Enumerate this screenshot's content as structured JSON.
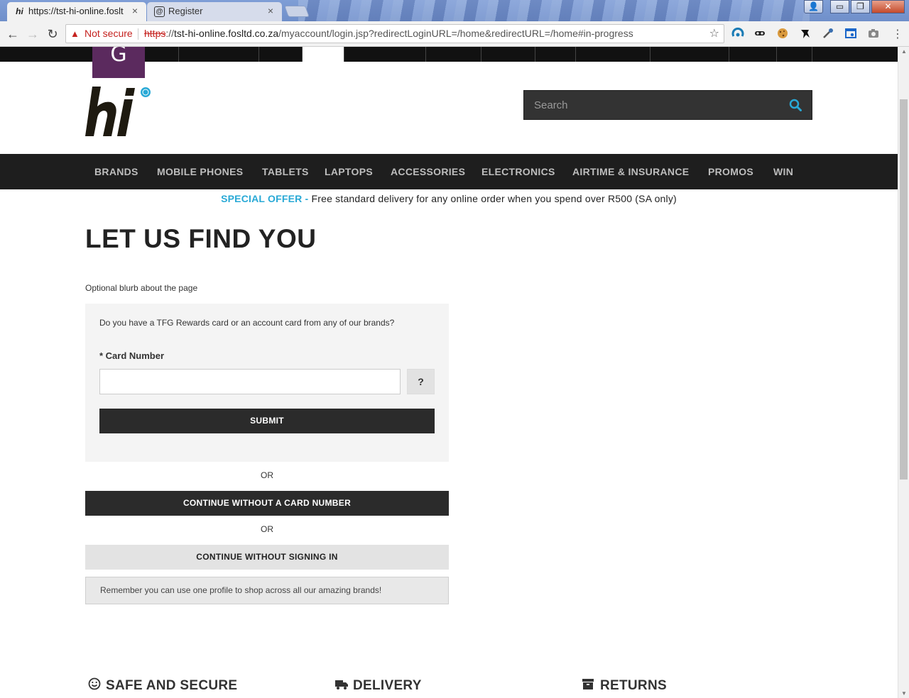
{
  "browser": {
    "tabs": [
      {
        "favicon": "hi",
        "title": "https://tst-hi-online.foslt",
        "close": "×"
      },
      {
        "favicon": "@",
        "title": "Register",
        "close": "×"
      }
    ],
    "window_buttons": {
      "minimize": "▭",
      "restore": "❐",
      "close": "✕",
      "user": "👤"
    },
    "nav": {
      "back": "←",
      "forward": "→",
      "reload": "↻"
    },
    "omnibox": {
      "warning_icon": "▲",
      "security_label": "Not secure",
      "scheme": "https",
      "scheme_rest": "://",
      "host": "tst-hi-online.fosltd.co.za",
      "path": "/myaccount/login.jsp?redirectLoginURL=/home&redirectURL=/home#in-progress",
      "star": "☆"
    },
    "menu": "⋮"
  },
  "brandbar": {
    "badge_letter": "G"
  },
  "search": {
    "placeholder": "Search"
  },
  "nav": {
    "items": [
      "BRANDS",
      "MOBILE PHONES",
      "TABLETS",
      "LAPTOPS",
      "ACCESSORIES",
      "ELECTRONICS",
      "AIRTIME & INSURANCE",
      "PROMOS",
      "WIN"
    ]
  },
  "offer": {
    "highlight": "SPECIAL OFFER -",
    "text": " Free standard delivery for any online order when you spend over R500 (SA only)"
  },
  "page": {
    "title": "LET US FIND YOU",
    "blurb": "Optional blurb about the page",
    "card_question": "Do you have a TFG Rewards card or an account card from any of our brands?",
    "card_label": "* Card Number",
    "card_value": "",
    "help_label": "?",
    "submit_label": "SUBMIT",
    "or_1": "OR",
    "continue_no_card": "CONTINUE WITHOUT A CARD NUMBER",
    "or_2": "OR",
    "continue_no_signin": "CONTINUE WITHOUT SIGNING IN",
    "reminder": "Remember you can use one profile to shop across all our amazing brands!"
  },
  "features": [
    {
      "label": "SAFE AND SECURE",
      "icon": "smiley-icon"
    },
    {
      "label": "DELIVERY",
      "icon": "truck-icon"
    },
    {
      "label": "RETURNS",
      "icon": "box-icon"
    }
  ],
  "colors": {
    "accent": "#29a9d6",
    "dark": "#2b2b2b",
    "nav_bg": "#1e1e1e",
    "badge": "#5b2a5e",
    "warning": "#c5221f"
  }
}
